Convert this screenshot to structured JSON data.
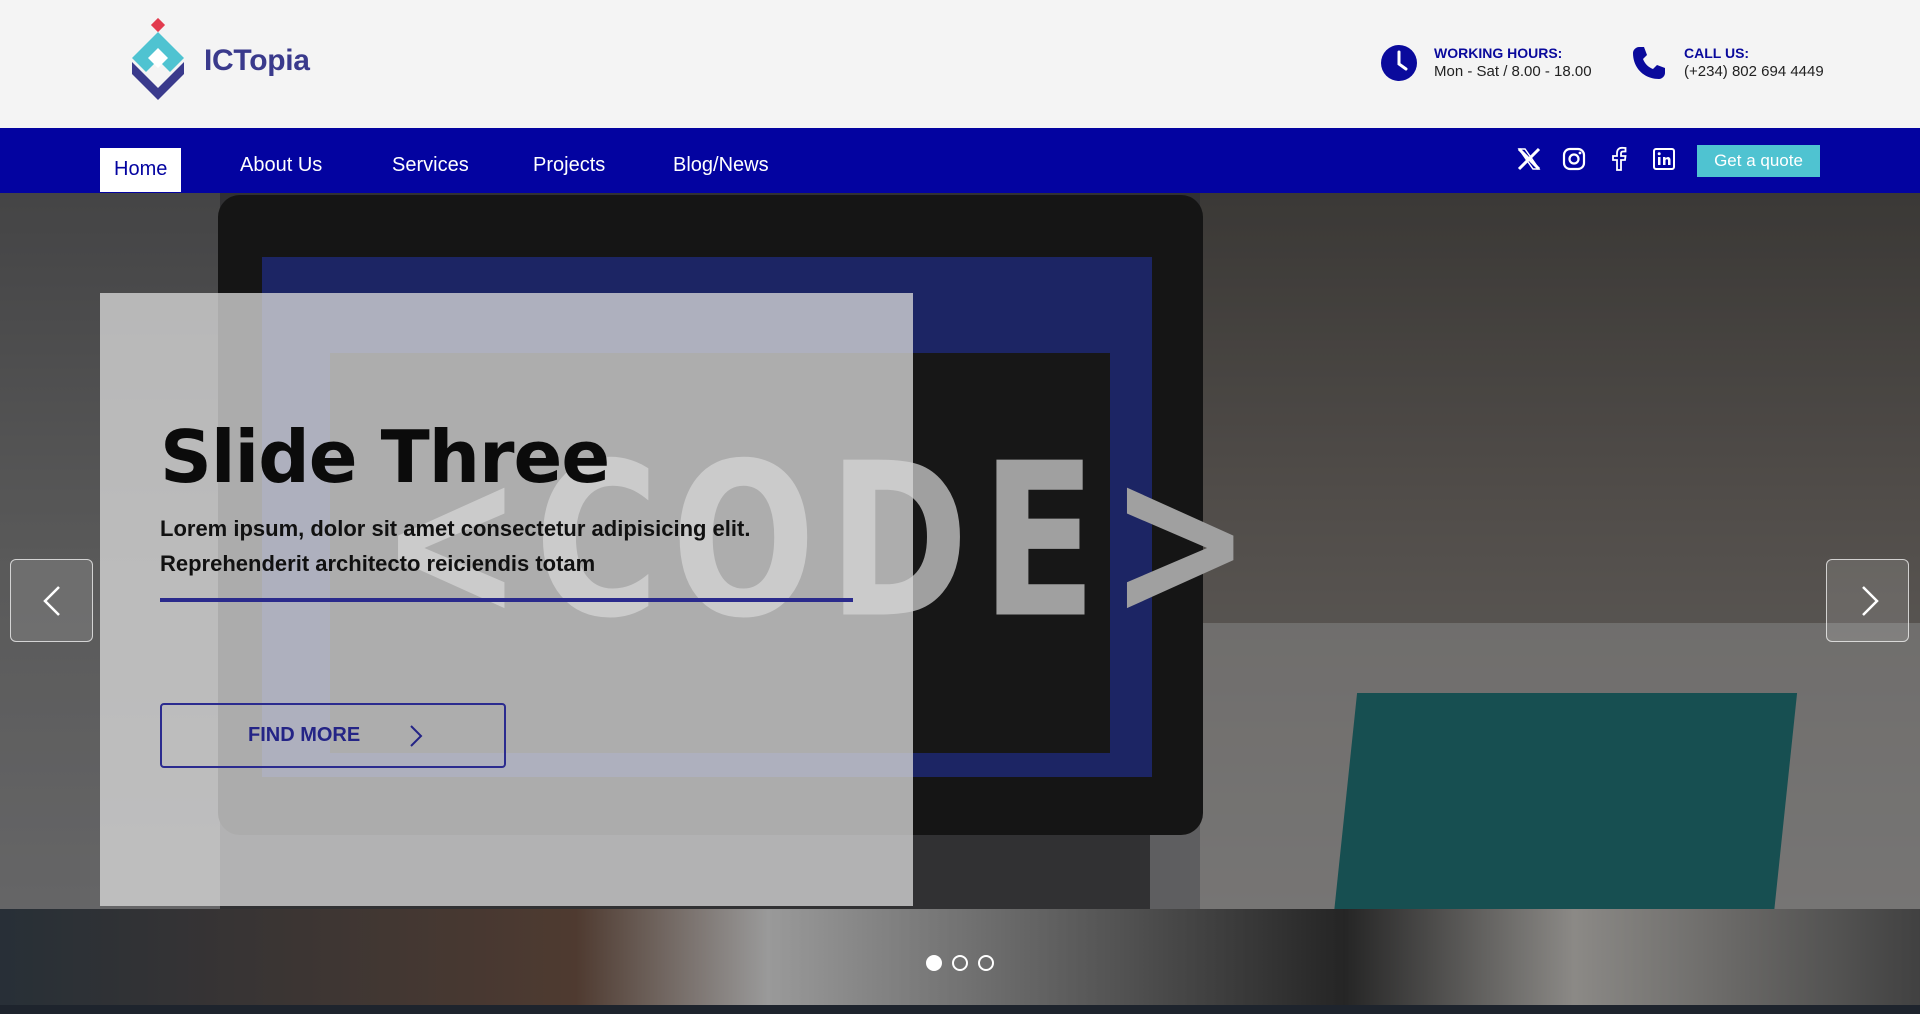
{
  "brand": {
    "name": "ICTopia",
    "primary_color": "#0303a0",
    "accent_color": "#4fc3d1"
  },
  "contact": {
    "hours_label": "WORKING HOURS:",
    "hours_value": "Mon - Sat / 8.00 - 18.00",
    "call_label": "CALL US:",
    "call_value": "(+234) 802 694 4449"
  },
  "nav": {
    "items": [
      {
        "label": "Home",
        "active": true
      },
      {
        "label": "About Us"
      },
      {
        "label": "Services"
      },
      {
        "label": "Projects"
      },
      {
        "label": "Blog/News"
      }
    ],
    "social_icons": [
      "x-icon",
      "instagram-icon",
      "facebook-icon",
      "linkedin-icon"
    ],
    "quote_label": "Get a quote"
  },
  "hero": {
    "title": "Slide Three",
    "text": "Lorem ipsum, dolor sit amet consectetur adipisicing elit. Reprehenderit architecto reiciendis totam",
    "button_label": "FIND MORE",
    "slide_count": 3,
    "active_slide": 1
  }
}
